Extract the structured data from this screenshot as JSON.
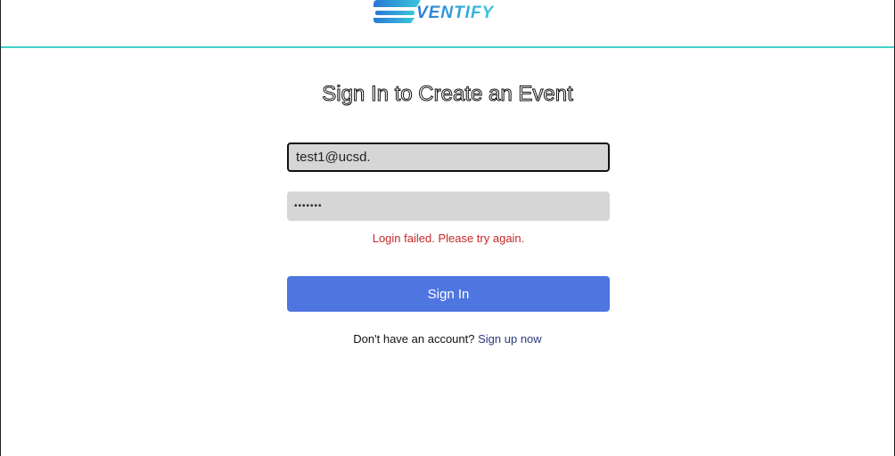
{
  "header": {
    "logo_text": "VENTIFY",
    "accent_color": "#3fd0c9"
  },
  "form": {
    "title": "Sign In to Create an Event",
    "email_value": "test1@ucsd.",
    "password_value": "•••••••",
    "error_message": "Login failed. Please try again.",
    "error_color": "#c62828",
    "signin_label": "Sign In",
    "signin_color": "#4f76e0",
    "signup_prompt": "Don't have an account?",
    "signup_link": "Sign up now"
  }
}
